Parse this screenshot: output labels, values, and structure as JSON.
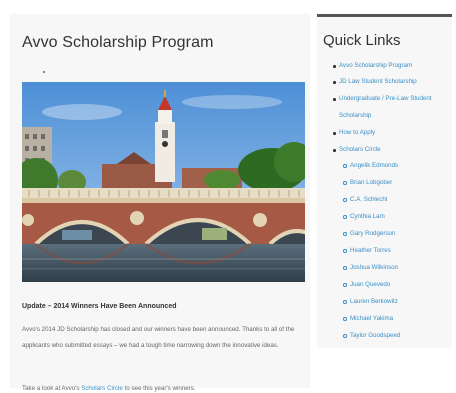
{
  "main": {
    "title": "Avvo Scholarship Program",
    "update_heading": "Update – 2014 Winners Have Been Announced",
    "para1": "Avvo's 2014 JD Scholarship has closed and our winners have been announced. Thanks to all of the applicants who submitted essays – we had a tough time narrowing down the innovative ideas.",
    "para2_prefix": "Take a look at Avvo's ",
    "para2_link": "Scholars Circle",
    "para2_suffix": " to see this year's winners."
  },
  "sidebar": {
    "title": "Quick Links",
    "items": [
      {
        "label": "Avvo Scholarship Program"
      },
      {
        "label": "JD Law Student Scholarship"
      },
      {
        "label": "Undergraduate / Pre-Law Student"
      },
      {
        "label": "Scholarship"
      },
      {
        "label": "How to Apply"
      },
      {
        "label": "Scholars Circle"
      }
    ],
    "scholars": [
      "Angelik Edmonds",
      "Brian Lobgober",
      "C.A. Schlecht",
      "Cynthia Lam",
      "Gary Rodgerson",
      "Heather Torres",
      "Joshua Wilkinson",
      "Juan Quevedo",
      "Lauren Berkowitz",
      "Michael Yakima",
      "Taylor Goodspeed"
    ]
  },
  "colors": {
    "link": "#3a8fc6",
    "text": "#666666",
    "heading": "#333333",
    "sidebar_border": "#555555",
    "panel_bg": "#f7f7f7"
  }
}
